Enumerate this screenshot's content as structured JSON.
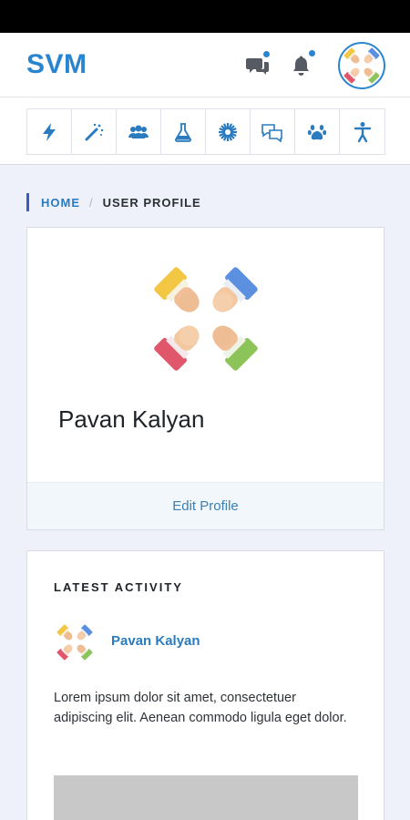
{
  "app": {
    "brand": "SVM"
  },
  "header": {
    "icons": [
      "chat-bubbles-icon",
      "bell-icon",
      "avatar"
    ],
    "accent": "#2a85d0"
  },
  "toolbar": {
    "icons": [
      "lightning-icon",
      "magic-wand-icon",
      "users-group-icon",
      "flask-icon",
      "sunburst-icon",
      "comments-icon",
      "paw-icon",
      "accessibility-icon"
    ]
  },
  "breadcrumb": {
    "home": "HOME",
    "separator": "/",
    "current": "USER PROFILE"
  },
  "profile": {
    "name": "Pavan Kalyan",
    "edit_label": "Edit Profile"
  },
  "activity": {
    "title": "LATEST ACTIVITY",
    "user": "Pavan Kalyan",
    "text": "Lorem ipsum dolor sit amet, consectetuer adipiscing elit. Aenean commodo ligula eget dolor."
  },
  "colors": {
    "brand": "#2a85d0",
    "link": "#2a7bbf",
    "background": "#eef0fa",
    "image_placeholder": "#c8c8c8"
  }
}
